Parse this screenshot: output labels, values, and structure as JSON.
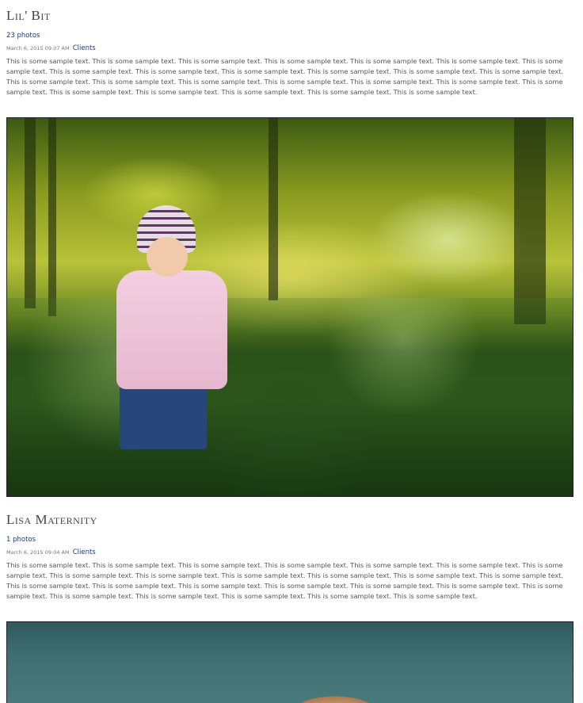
{
  "posts": [
    {
      "title": "Lil' Bit",
      "photo_count": "23 photos",
      "date": "March 6, 2015 09:07 AM",
      "category": "Clients",
      "excerpt": "This is some sample text. This is some sample text. This is some sample text. This is some sample text. This is some sample text. This is some sample text. This is some sample text. This is some sample text. This is some sample text. This is some sample text. This is some sample text. This is some sample text. This is some sample text. This is some sample text. This is some sample text. This is some sample text. This is some sample text. This is some sample text. This is some sample text. This is some sample text. This is some sample text. This is some sample text. This is some sample text. This is some sample text. This is some sample text."
    },
    {
      "title": "Lisa Maternity",
      "photo_count": "1 photos",
      "date": "March 6, 2015 09:04 AM",
      "category": "Clients",
      "excerpt": "This is some sample text. This is some sample text. This is some sample text. This is some sample text. This is some sample text. This is some sample text. This is some sample text. This is some sample text. This is some sample text. This is some sample text. This is some sample text. This is some sample text. This is some sample text. This is some sample text. This is some sample text. This is some sample text. This is some sample text. This is some sample text. This is some sample text. This is some sample text. This is some sample text. This is some sample text. This is some sample text. This is some sample text. This is some sample text."
    }
  ],
  "colors": {
    "link": "#1e3a7a",
    "title": "#444444",
    "text": "#555555"
  }
}
